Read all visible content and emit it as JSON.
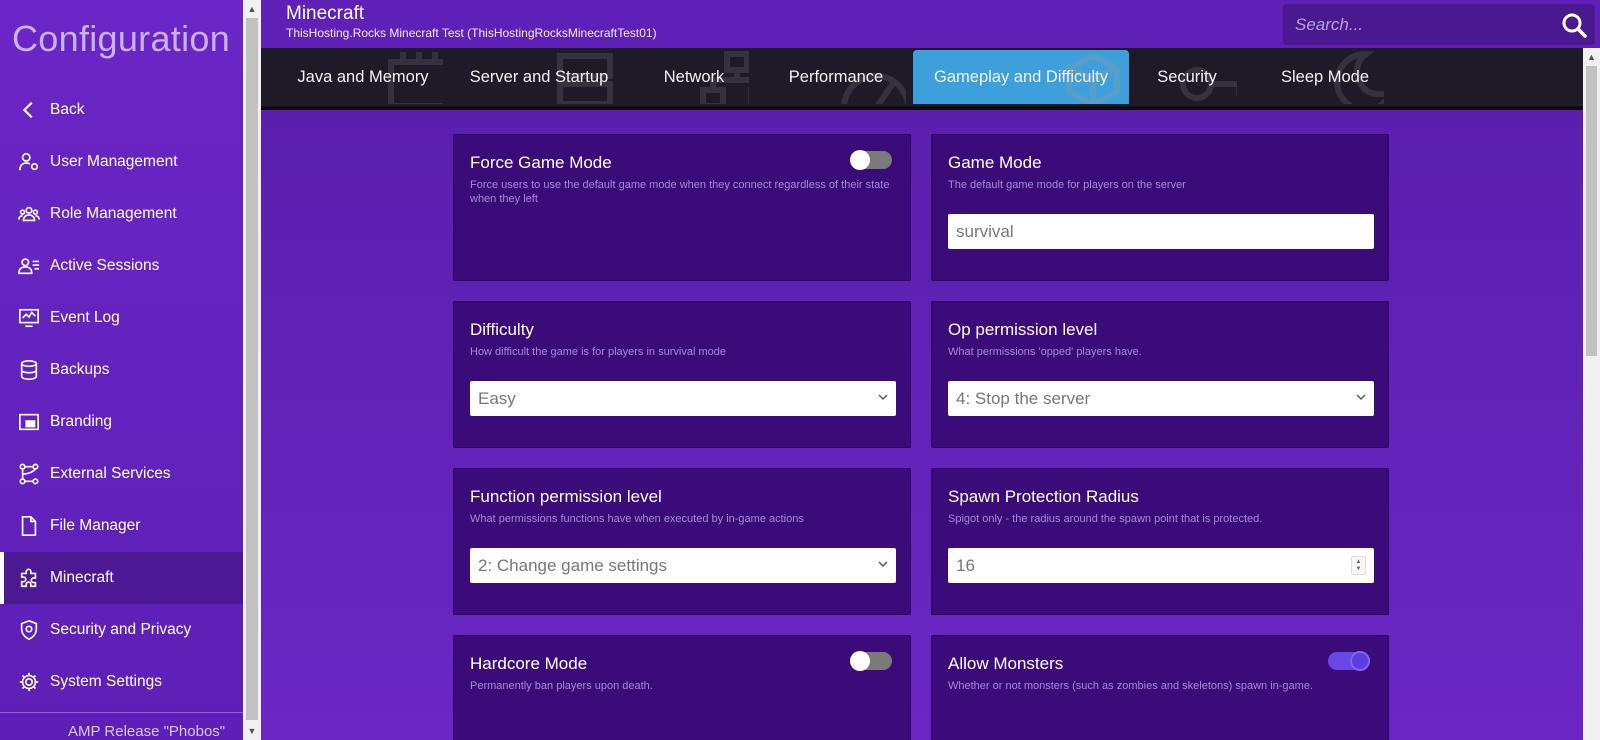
{
  "sidebar": {
    "title": "Configuration",
    "items": [
      {
        "label": "Back",
        "icon": "chevron-left-icon"
      },
      {
        "label": "User Management",
        "icon": "user-gear-icon"
      },
      {
        "label": "Role Management",
        "icon": "users-icon"
      },
      {
        "label": "Active Sessions",
        "icon": "user-list-icon"
      },
      {
        "label": "Event Log",
        "icon": "monitor-chart-icon"
      },
      {
        "label": "Backups",
        "icon": "database-icon"
      },
      {
        "label": "Branding",
        "icon": "picture-frame-icon"
      },
      {
        "label": "External Services",
        "icon": "network-icon"
      },
      {
        "label": "File Manager",
        "icon": "file-icon"
      },
      {
        "label": "Minecraft",
        "icon": "puzzle-icon",
        "active": true
      },
      {
        "label": "Security and Privacy",
        "icon": "shield-icon"
      },
      {
        "label": "System Settings",
        "icon": "gear-icon"
      }
    ],
    "footer": "AMP Release \"Phobos\""
  },
  "header": {
    "title": "Minecraft",
    "subtitle": "ThisHosting.Rocks Minecraft Test (ThisHostingRocksMinecraftTest01)",
    "search_placeholder": "Search..."
  },
  "tabs": [
    {
      "label": "Java and Memory"
    },
    {
      "label": "Server and Startup"
    },
    {
      "label": "Network"
    },
    {
      "label": "Performance"
    },
    {
      "label": "Gameplay and Difficulty",
      "active": true
    },
    {
      "label": "Security"
    },
    {
      "label": "Sleep Mode"
    }
  ],
  "settings": {
    "force_game_mode": {
      "title": "Force Game Mode",
      "desc": "Force users to use the default game mode when they connect regardless of their state when they left",
      "enabled": false
    },
    "game_mode": {
      "title": "Game Mode",
      "desc": "The default game mode for players on the server",
      "value": "survival"
    },
    "difficulty": {
      "title": "Difficulty",
      "desc": "How difficult the game is for players in survival mode",
      "value": "Easy"
    },
    "op_permission": {
      "title": "Op permission level",
      "desc": "What permissions 'opped' players have.",
      "value": "4: Stop the server"
    },
    "function_permission": {
      "title": "Function permission level",
      "desc": "What permissions functions have when executed by in-game actions",
      "value": "2: Change game settings"
    },
    "spawn_protection": {
      "title": "Spawn Protection Radius",
      "desc": "Spigot only - the radius around the spawn point that is protected.",
      "value": "16"
    },
    "hardcore": {
      "title": "Hardcore Mode",
      "desc": "Permanently ban players upon death.",
      "enabled": false
    },
    "allow_monsters": {
      "title": "Allow Monsters",
      "desc": "Whether or not monsters (such as zombies and skeletons) spawn in-game.",
      "enabled": true
    }
  },
  "colors": {
    "accent": "#3da0dc",
    "sidebar": "#6a26c6",
    "card": "#3c0b7a",
    "toggle_on": "#6747e6"
  }
}
